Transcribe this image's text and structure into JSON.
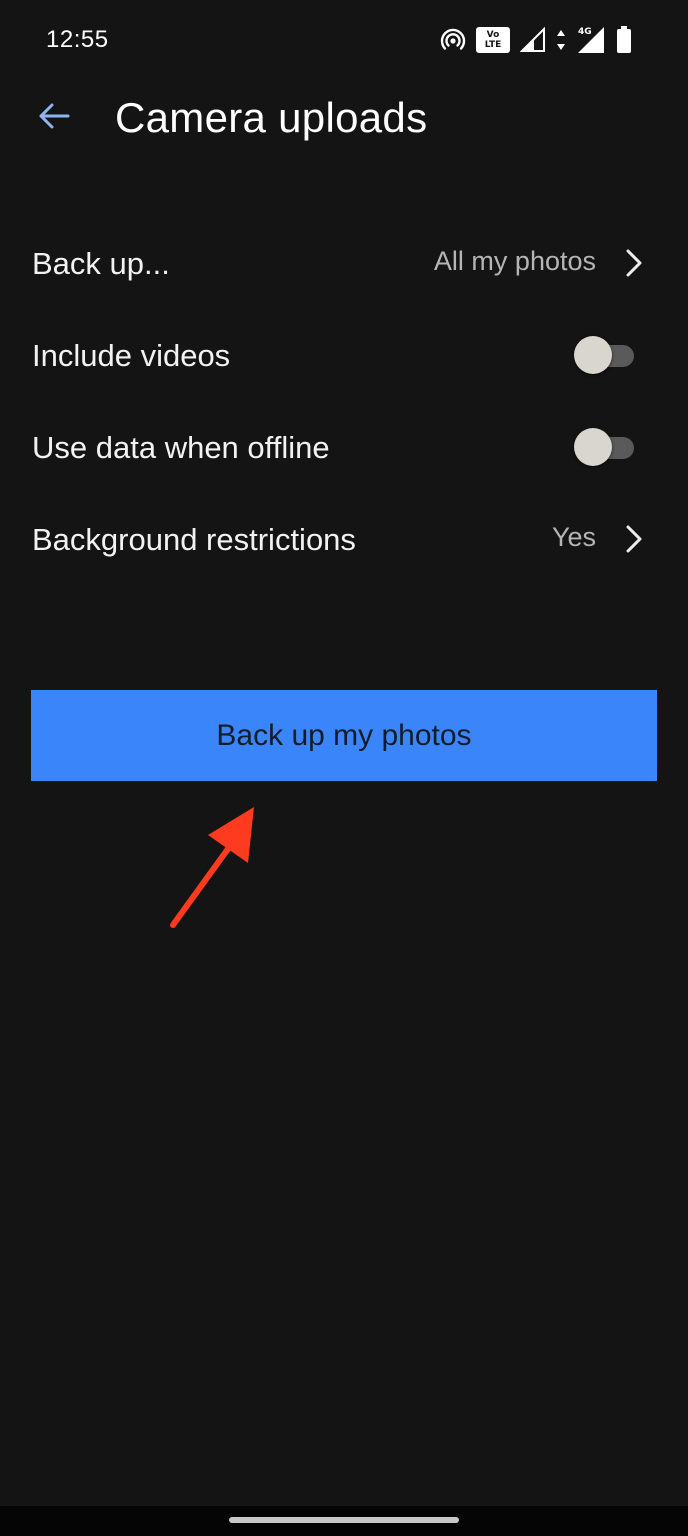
{
  "status_bar": {
    "time": "12:55",
    "volte_line1": "Vo",
    "volte_line2": "LTE",
    "network_label": "4G"
  },
  "header": {
    "title": "Camera uploads",
    "back_icon": "arrow-left-icon"
  },
  "settings": {
    "back_up": {
      "label": "Back up...",
      "value": "All my photos"
    },
    "include_videos": {
      "label": "Include videos",
      "enabled": false
    },
    "use_data_offline": {
      "label": "Use data when offline",
      "enabled": false
    },
    "background_restrictions": {
      "label": "Background restrictions",
      "value": "Yes"
    }
  },
  "primary_action": {
    "label": "Back up my photos"
  },
  "colors": {
    "background": "#141414",
    "accent": "#3b85fa",
    "back_arrow": "#8fb4f2",
    "annotation": "#ff3b1f",
    "toggle_track": "#5a5a5a",
    "toggle_thumb": "#d9d6d0"
  }
}
